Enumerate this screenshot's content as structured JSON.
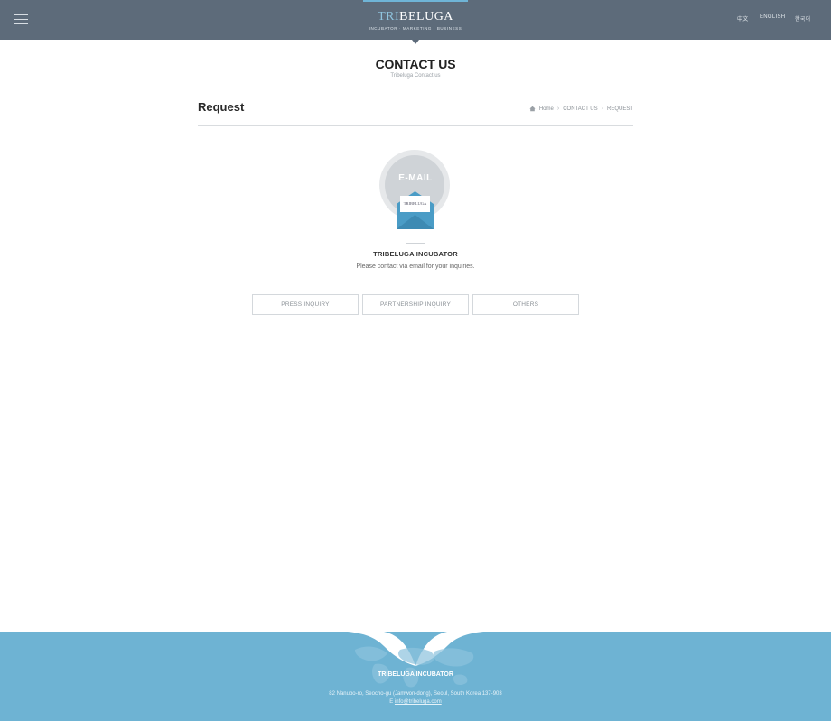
{
  "header": {
    "logo_tri": "TRI",
    "logo_rest": "BELUGA",
    "logo_tagline": "INCUBATOR · MARKETING · BUSINESS",
    "languages": [
      "中文",
      "ENGLISH",
      "한국어"
    ]
  },
  "page": {
    "title": "CONTACT US",
    "subtitle": "Tribeluga Contact us"
  },
  "section": {
    "title": "Request",
    "breadcrumb": [
      "Home",
      "CONTACT US",
      "REQUEST"
    ]
  },
  "badge": {
    "label": "E-MAIL",
    "card_text": "TRIBELUGA"
  },
  "content": {
    "org_name": "TRIBELUGA INCUBATOR",
    "description": "Please contact via email for your inquiries."
  },
  "inquiry_buttons": [
    "PRESS INQUIRY",
    "PARTNERSHIP INQUIRY",
    "OTHERS"
  ],
  "footer": {
    "name": "TRIBELUGA INCUBATOR",
    "address": "82 Nanubo-ro, Seocho-gu (Jamwon-dong), Seoul, South Korea 137-903",
    "email_prefix": "E",
    "email": "info@tribeluga.com"
  },
  "colors": {
    "header_bg": "#5d6b7a",
    "accent": "#6fb4d6",
    "footer_bg": "#6eb3d3",
    "envelope": "#4a9cc6"
  },
  "icons": [
    "menu-icon",
    "home-icon",
    "envelope-icon",
    "world-map"
  ]
}
